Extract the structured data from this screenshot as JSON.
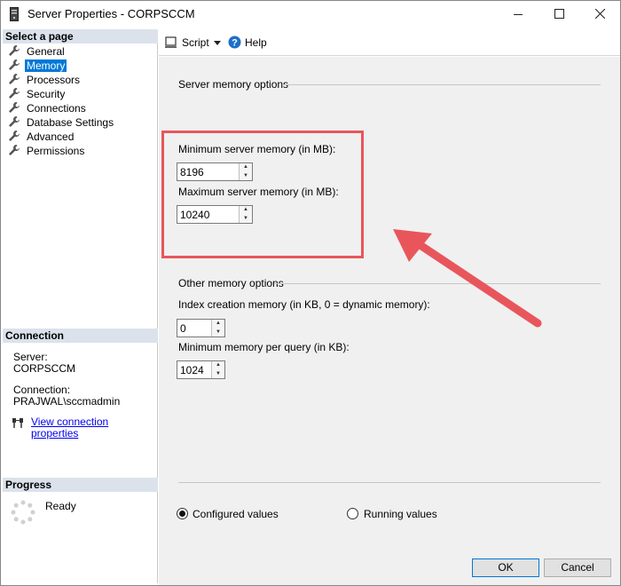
{
  "window": {
    "title": "Server Properties - CORPSCCM"
  },
  "sidebar": {
    "select_page_header": "Select a page",
    "items": [
      {
        "label": "General",
        "selected": false
      },
      {
        "label": "Memory",
        "selected": true
      },
      {
        "label": "Processors",
        "selected": false
      },
      {
        "label": "Security",
        "selected": false
      },
      {
        "label": "Connections",
        "selected": false
      },
      {
        "label": "Database Settings",
        "selected": false
      },
      {
        "label": "Advanced",
        "selected": false
      },
      {
        "label": "Permissions",
        "selected": false
      }
    ],
    "connection_header": "Connection",
    "server_label": "Server:",
    "server_value": "CORPSCCM",
    "connection_label": "Connection:",
    "connection_value": "PRAJWAL\\sccmadmin",
    "view_props_link": "View connection properties",
    "progress_header": "Progress",
    "progress_status": "Ready"
  },
  "toolbar": {
    "script_label": "Script",
    "help_label": "Help"
  },
  "main": {
    "server_memory_group": "Server memory options",
    "min_memory_label": "Minimum server memory (in MB):",
    "min_memory_value": "8196",
    "max_memory_label": "Maximum server memory (in MB):",
    "max_memory_value": "10240",
    "other_memory_group": "Other memory options",
    "index_memory_label": "Index creation memory (in KB, 0 = dynamic memory):",
    "index_memory_value": "0",
    "min_query_label": "Minimum memory per query (in KB):",
    "min_query_value": "1024",
    "configured_label": "Configured values",
    "running_label": "Running values",
    "configured_selected": true
  },
  "footer": {
    "ok_label": "OK",
    "cancel_label": "Cancel"
  },
  "colors": {
    "accent": "#0078d7",
    "highlight": "#e8565b",
    "header_bg": "#dbe2ec"
  }
}
